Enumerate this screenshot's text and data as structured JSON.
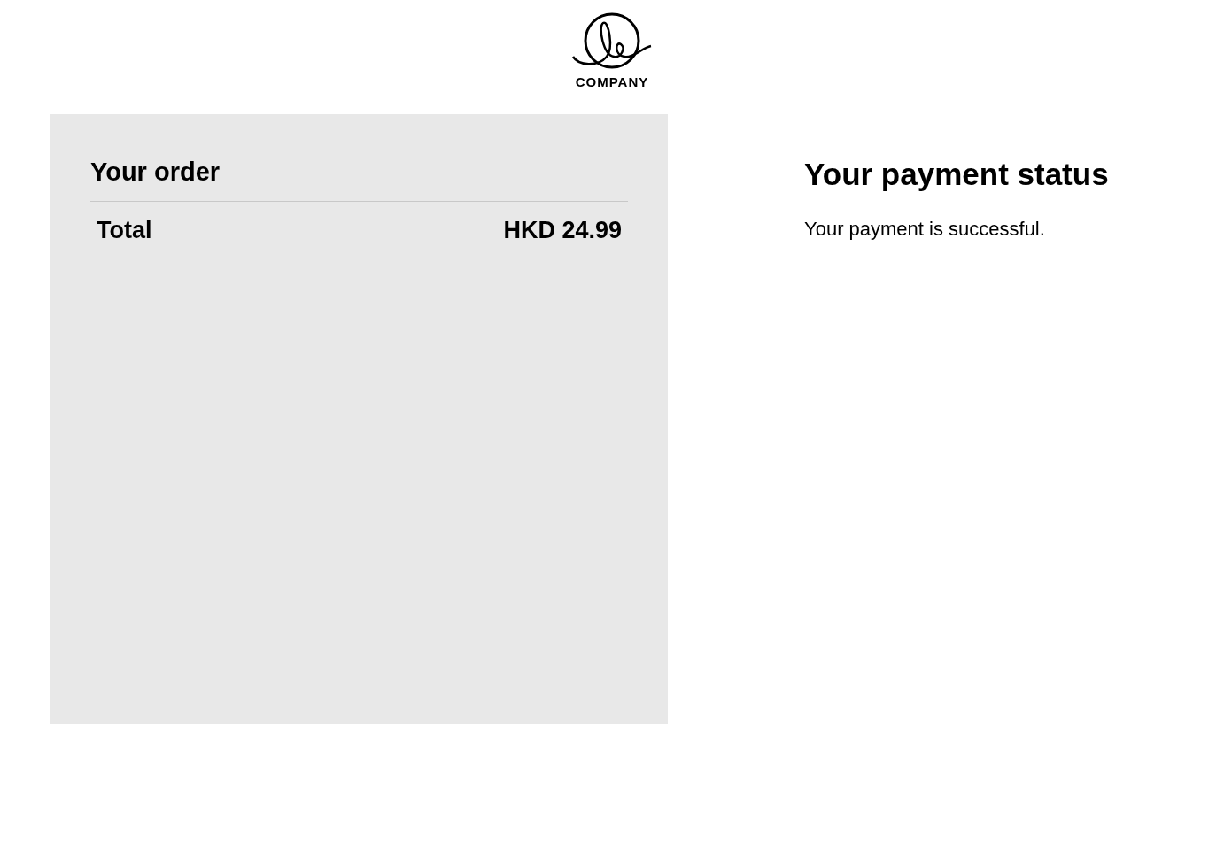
{
  "header": {
    "logo_text": "COMPANY"
  },
  "order": {
    "title": "Your order",
    "total_label": "Total",
    "total_value": "HKD 24.99"
  },
  "status": {
    "title": "Your payment status",
    "message": "Your payment is successful."
  }
}
